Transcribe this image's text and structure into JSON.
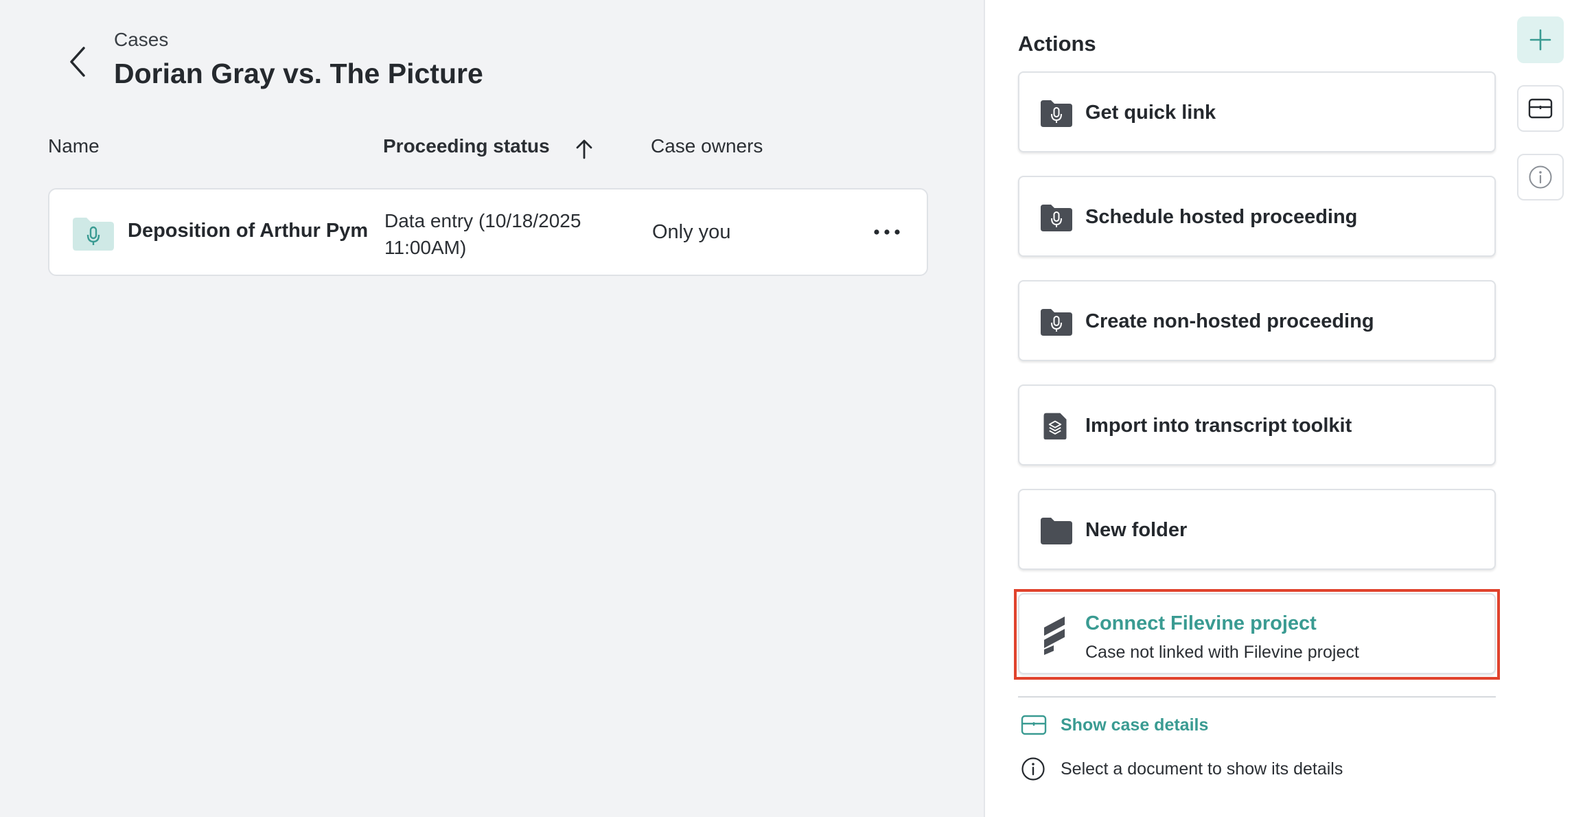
{
  "header": {
    "breadcrumb": "Cases",
    "title": "Dorian Gray vs. The Picture"
  },
  "table": {
    "columns": [
      "Name",
      "Proceeding status",
      "Case owners"
    ],
    "sort_column": "Proceeding status",
    "rows": [
      {
        "name": "Deposition of Arthur Pym",
        "status_line1": "Data entry (10/18/2025",
        "status_line2": "11:00AM)",
        "owners": "Only you",
        "more_label": "···"
      }
    ]
  },
  "panel": {
    "title": "Actions",
    "actions": [
      {
        "label": "Get quick link",
        "icon": "folder-mic-icon"
      },
      {
        "label": "Schedule hosted proceeding",
        "icon": "folder-mic-icon"
      },
      {
        "label": "Create non-hosted proceeding",
        "icon": "folder-mic-icon"
      },
      {
        "label": "Import into transcript toolkit",
        "icon": "document-layers-icon"
      },
      {
        "label": "New folder",
        "icon": "folder-icon"
      }
    ],
    "filevine": {
      "title": "Connect Filevine project",
      "subtitle": "Case not linked with Filevine project",
      "icon": "filevine-logo-icon"
    },
    "show_case_details": "Show case details",
    "doc_hint": "Select a document to show its details"
  },
  "rail": {
    "buttons": [
      "add-icon",
      "case-card-icon",
      "info-icon"
    ]
  },
  "colors": {
    "accent": "#3a9b92",
    "highlight": "#e0432d",
    "icon_dark": "#4a4e55"
  }
}
